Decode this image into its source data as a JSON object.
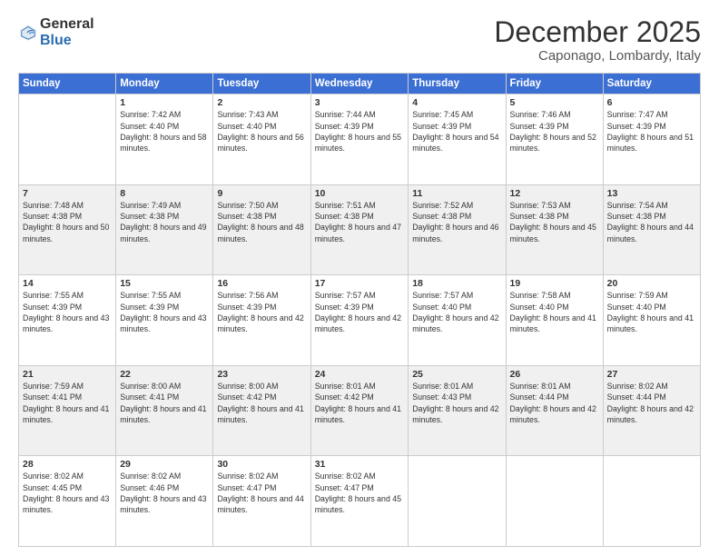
{
  "header": {
    "logo_general": "General",
    "logo_blue": "Blue",
    "month": "December 2025",
    "location": "Caponago, Lombardy, Italy"
  },
  "days_of_week": [
    "Sunday",
    "Monday",
    "Tuesday",
    "Wednesday",
    "Thursday",
    "Friday",
    "Saturday"
  ],
  "weeks": [
    [
      {
        "day": "",
        "sunrise": "",
        "sunset": "",
        "daylight": ""
      },
      {
        "day": "1",
        "sunrise": "Sunrise: 7:42 AM",
        "sunset": "Sunset: 4:40 PM",
        "daylight": "Daylight: 8 hours and 58 minutes."
      },
      {
        "day": "2",
        "sunrise": "Sunrise: 7:43 AM",
        "sunset": "Sunset: 4:40 PM",
        "daylight": "Daylight: 8 hours and 56 minutes."
      },
      {
        "day": "3",
        "sunrise": "Sunrise: 7:44 AM",
        "sunset": "Sunset: 4:39 PM",
        "daylight": "Daylight: 8 hours and 55 minutes."
      },
      {
        "day": "4",
        "sunrise": "Sunrise: 7:45 AM",
        "sunset": "Sunset: 4:39 PM",
        "daylight": "Daylight: 8 hours and 54 minutes."
      },
      {
        "day": "5",
        "sunrise": "Sunrise: 7:46 AM",
        "sunset": "Sunset: 4:39 PM",
        "daylight": "Daylight: 8 hours and 52 minutes."
      },
      {
        "day": "6",
        "sunrise": "Sunrise: 7:47 AM",
        "sunset": "Sunset: 4:39 PM",
        "daylight": "Daylight: 8 hours and 51 minutes."
      }
    ],
    [
      {
        "day": "7",
        "sunrise": "Sunrise: 7:48 AM",
        "sunset": "Sunset: 4:38 PM",
        "daylight": "Daylight: 8 hours and 50 minutes."
      },
      {
        "day": "8",
        "sunrise": "Sunrise: 7:49 AM",
        "sunset": "Sunset: 4:38 PM",
        "daylight": "Daylight: 8 hours and 49 minutes."
      },
      {
        "day": "9",
        "sunrise": "Sunrise: 7:50 AM",
        "sunset": "Sunset: 4:38 PM",
        "daylight": "Daylight: 8 hours and 48 minutes."
      },
      {
        "day": "10",
        "sunrise": "Sunrise: 7:51 AM",
        "sunset": "Sunset: 4:38 PM",
        "daylight": "Daylight: 8 hours and 47 minutes."
      },
      {
        "day": "11",
        "sunrise": "Sunrise: 7:52 AM",
        "sunset": "Sunset: 4:38 PM",
        "daylight": "Daylight: 8 hours and 46 minutes."
      },
      {
        "day": "12",
        "sunrise": "Sunrise: 7:53 AM",
        "sunset": "Sunset: 4:38 PM",
        "daylight": "Daylight: 8 hours and 45 minutes."
      },
      {
        "day": "13",
        "sunrise": "Sunrise: 7:54 AM",
        "sunset": "Sunset: 4:38 PM",
        "daylight": "Daylight: 8 hours and 44 minutes."
      }
    ],
    [
      {
        "day": "14",
        "sunrise": "Sunrise: 7:55 AM",
        "sunset": "Sunset: 4:39 PM",
        "daylight": "Daylight: 8 hours and 43 minutes."
      },
      {
        "day": "15",
        "sunrise": "Sunrise: 7:55 AM",
        "sunset": "Sunset: 4:39 PM",
        "daylight": "Daylight: 8 hours and 43 minutes."
      },
      {
        "day": "16",
        "sunrise": "Sunrise: 7:56 AM",
        "sunset": "Sunset: 4:39 PM",
        "daylight": "Daylight: 8 hours and 42 minutes."
      },
      {
        "day": "17",
        "sunrise": "Sunrise: 7:57 AM",
        "sunset": "Sunset: 4:39 PM",
        "daylight": "Daylight: 8 hours and 42 minutes."
      },
      {
        "day": "18",
        "sunrise": "Sunrise: 7:57 AM",
        "sunset": "Sunset: 4:40 PM",
        "daylight": "Daylight: 8 hours and 42 minutes."
      },
      {
        "day": "19",
        "sunrise": "Sunrise: 7:58 AM",
        "sunset": "Sunset: 4:40 PM",
        "daylight": "Daylight: 8 hours and 41 minutes."
      },
      {
        "day": "20",
        "sunrise": "Sunrise: 7:59 AM",
        "sunset": "Sunset: 4:40 PM",
        "daylight": "Daylight: 8 hours and 41 minutes."
      }
    ],
    [
      {
        "day": "21",
        "sunrise": "Sunrise: 7:59 AM",
        "sunset": "Sunset: 4:41 PM",
        "daylight": "Daylight: 8 hours and 41 minutes."
      },
      {
        "day": "22",
        "sunrise": "Sunrise: 8:00 AM",
        "sunset": "Sunset: 4:41 PM",
        "daylight": "Daylight: 8 hours and 41 minutes."
      },
      {
        "day": "23",
        "sunrise": "Sunrise: 8:00 AM",
        "sunset": "Sunset: 4:42 PM",
        "daylight": "Daylight: 8 hours and 41 minutes."
      },
      {
        "day": "24",
        "sunrise": "Sunrise: 8:01 AM",
        "sunset": "Sunset: 4:42 PM",
        "daylight": "Daylight: 8 hours and 41 minutes."
      },
      {
        "day": "25",
        "sunrise": "Sunrise: 8:01 AM",
        "sunset": "Sunset: 4:43 PM",
        "daylight": "Daylight: 8 hours and 42 minutes."
      },
      {
        "day": "26",
        "sunrise": "Sunrise: 8:01 AM",
        "sunset": "Sunset: 4:44 PM",
        "daylight": "Daylight: 8 hours and 42 minutes."
      },
      {
        "day": "27",
        "sunrise": "Sunrise: 8:02 AM",
        "sunset": "Sunset: 4:44 PM",
        "daylight": "Daylight: 8 hours and 42 minutes."
      }
    ],
    [
      {
        "day": "28",
        "sunrise": "Sunrise: 8:02 AM",
        "sunset": "Sunset: 4:45 PM",
        "daylight": "Daylight: 8 hours and 43 minutes."
      },
      {
        "day": "29",
        "sunrise": "Sunrise: 8:02 AM",
        "sunset": "Sunset: 4:46 PM",
        "daylight": "Daylight: 8 hours and 43 minutes."
      },
      {
        "day": "30",
        "sunrise": "Sunrise: 8:02 AM",
        "sunset": "Sunset: 4:47 PM",
        "daylight": "Daylight: 8 hours and 44 minutes."
      },
      {
        "day": "31",
        "sunrise": "Sunrise: 8:02 AM",
        "sunset": "Sunset: 4:47 PM",
        "daylight": "Daylight: 8 hours and 45 minutes."
      },
      {
        "day": "",
        "sunrise": "",
        "sunset": "",
        "daylight": ""
      },
      {
        "day": "",
        "sunrise": "",
        "sunset": "",
        "daylight": ""
      },
      {
        "day": "",
        "sunrise": "",
        "sunset": "",
        "daylight": ""
      }
    ]
  ]
}
